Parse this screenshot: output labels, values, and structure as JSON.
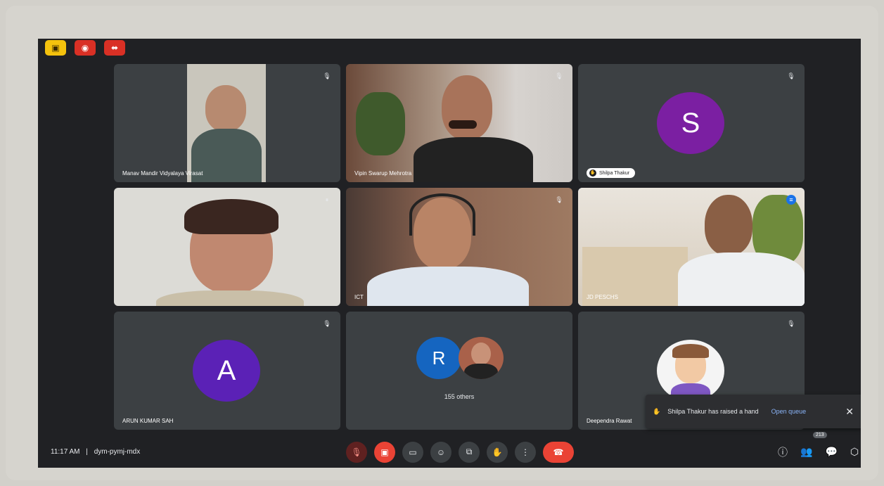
{
  "participants": {
    "p1_name": "Manav Mandir Vidyalaya Virasat",
    "p2_name": "Vipin Swarup Mehrotra",
    "p3_letter": "S",
    "p3_name": "Shilpa Thakur",
    "p5_name": "ICT",
    "p6_name": "JD PESCHS",
    "p7_letter": "A",
    "p7_name": "ARUN KUMAR SAH",
    "p8_letter": "R",
    "p8_others": "155 others",
    "p9_name": "Deependra Rawat"
  },
  "toast": {
    "message": "Shilpa Thakur has raised a hand",
    "action": "Open queue"
  },
  "meeting": {
    "time": "11:17 AM",
    "separator": "|",
    "code": "dym-pymj-mdx",
    "participant_count": "213"
  },
  "colors": {
    "background": "#202124",
    "tile": "#3c4043",
    "avatar_purple": "#7b1fa2",
    "avatar_indigo": "#5b21b6",
    "avatar_blue": "#1565c0",
    "end_call": "#ea4335"
  }
}
